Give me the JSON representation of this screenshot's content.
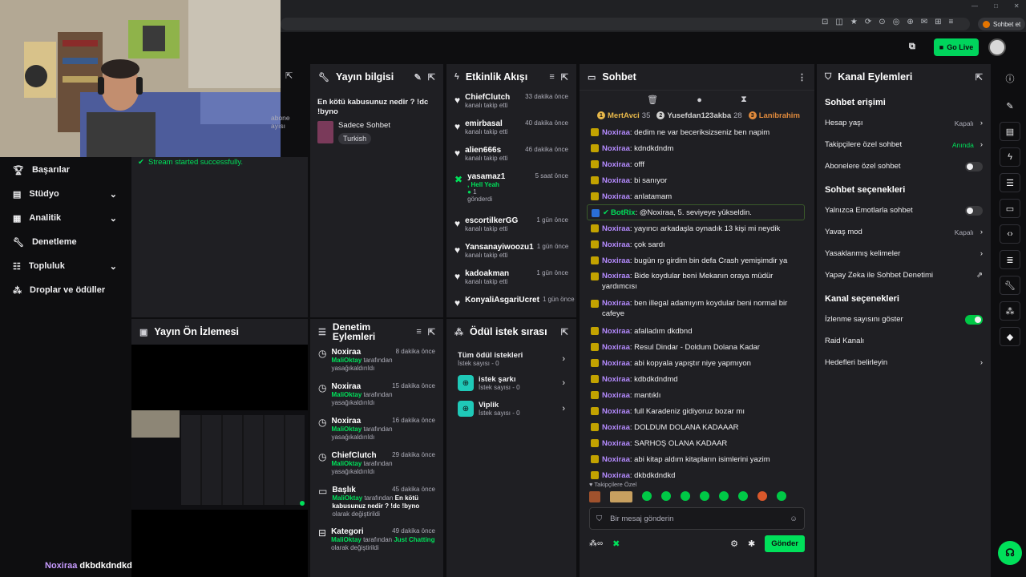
{
  "browser": {
    "profile_label": "Sohbet et"
  },
  "header": {
    "go_live": "Go Live"
  },
  "overlay": {
    "chat_user": "Noxiraa",
    "chat_text": "dkbdkdndkd",
    "partial_text": "abone\nayısı"
  },
  "sidebar": {
    "items": [
      {
        "label": "Başarılar",
        "icon": "trophy-icon"
      },
      {
        "label": "Stüdyo",
        "icon": "studio-icon",
        "expandable": true
      },
      {
        "label": "Analitik",
        "icon": "chart-icon",
        "expandable": true
      },
      {
        "label": "Denetleme",
        "icon": "wrench-icon"
      },
      {
        "label": "Topluluk",
        "icon": "community-icon",
        "expandable": true
      },
      {
        "label": "Droplar ve ödüller",
        "icon": "gift-icon"
      }
    ]
  },
  "stream_status": {
    "text": "Stream started successfully."
  },
  "stream_info": {
    "title": "Yayın bilgisi",
    "stream_title": "En kötü kabusunuz nedir ? !dc !byno",
    "category": "Sadece Sohbet",
    "tag": "Turkish"
  },
  "activity": {
    "title": "Etkinlik Akışı",
    "items": [
      {
        "name": "ChiefClutch",
        "sub": "kanalı takip etti",
        "time": "33 dakika önce"
      },
      {
        "name": "emirbasal",
        "sub": "kanalı takip etti",
        "time": "40 dakika önce"
      },
      {
        "name": "alien666s",
        "sub": "kanalı takip etti",
        "time": "46 dakika önce"
      },
      {
        "name": "yasamaz1",
        "sub": ", Hell Yeah",
        "sub2": "1",
        "sub3": "gönderdi",
        "time": "5 saat önce"
      },
      {
        "name": "escortilkerGG",
        "sub": "kanalı takip etti",
        "time": "1 gün önce"
      },
      {
        "name": "Yansanayiwoozu1",
        "sub": "kanalı takip etti",
        "time": "1 gün önce"
      },
      {
        "name": "kadoakman",
        "sub": "kanalı takip etti",
        "time": "1 gün önce"
      },
      {
        "name": "KonyaliAsgariUcret",
        "sub": "",
        "time": "1 gün önce"
      }
    ]
  },
  "chat": {
    "title": "Sohbet",
    "leaders": [
      {
        "rank": "1",
        "name": "MertAvci",
        "score": "35",
        "color": "#e8b84a"
      },
      {
        "rank": "2",
        "name": "Yusefdan123akba",
        "score": "28",
        "color": "#d0d0d0"
      },
      {
        "rank": "3",
        "name": "Lanibrahim",
        "score": "",
        "color": "#e08a3c"
      }
    ],
    "messages": [
      {
        "user": "Noxiraa",
        "text": ": dedim ne var beceriksizseniz ben napim"
      },
      {
        "user": "Noxiraa",
        "text": ": kdndkdndm"
      },
      {
        "user": "Noxiraa",
        "text": ": offf"
      },
      {
        "user": "Noxiraa",
        "text": ": bi sanıyor"
      },
      {
        "user": "Noxiraa",
        "text": ": anlatamam"
      },
      {
        "user": "BotRix",
        "text": ": @Noxiraa, 5. seviyeye yükseldin.",
        "bot": true
      },
      {
        "user": "Noxiraa",
        "text": ": yayıncı arkadaşla oynadık 13 kişi mi neydik"
      },
      {
        "user": "Noxiraa",
        "text": ": çok sardı"
      },
      {
        "user": "Noxiraa",
        "text": ": bugün rp girdim bin defa Crash yemişimdir ya"
      },
      {
        "user": "Noxiraa",
        "text": ": Bide koydular beni Mekanın oraya müdür yardımcısı",
        "two": true
      },
      {
        "user": "Noxiraa",
        "text": ": ben illegal adamıyım koydular beni normal bir cafeye",
        "two": true
      },
      {
        "user": "Noxiraa",
        "text": ": afalladım dkdbnd"
      },
      {
        "user": "Noxiraa",
        "text": ": Resul Dindar - Doldum Dolana Kadar"
      },
      {
        "user": "Noxiraa",
        "text": ": abi kopyala yapıştır niye yapmıyon"
      },
      {
        "user": "Noxiraa",
        "text": ": kdbdkdndmd"
      },
      {
        "user": "Noxiraa",
        "text": ": mantıklı"
      },
      {
        "user": "Noxiraa",
        "text": ": full Karadeniz gidiyoruz bozar mı"
      },
      {
        "user": "Noxiraa",
        "text": ": DOLDUM DOLANA KADAAAR"
      },
      {
        "user": "Noxiraa",
        "text": ": SARHOŞ OLANA KADAAR"
      },
      {
        "user": "Noxiraa",
        "text": ": abi kitap aldım kitapların isimlerini yazim"
      },
      {
        "user": "Noxiraa",
        "text": ": dkbdkdndkd"
      }
    ],
    "emote_section": "Takipçilere Özel",
    "input_placeholder": "Bir mesaj gönderin",
    "send_label": "Gönder"
  },
  "channel_actions": {
    "title": "Kanal Eylemleri",
    "sections": [
      {
        "heading": "Sohbet erişimi",
        "rows": [
          {
            "label": "Hesap yaşı",
            "value": "Kapalı",
            "kind": "arrow"
          },
          {
            "label": "Takipçilere özel sohbet",
            "value": "Anında",
            "kind": "arrow",
            "value_green": true
          },
          {
            "label": "Abonelere özel sohbet",
            "value": "",
            "kind": "toggle",
            "on": false
          }
        ]
      },
      {
        "heading": "Sohbet seçenekleri",
        "rows": [
          {
            "label": "Yalnızca Emotlarla sohbet",
            "value": "",
            "kind": "toggle",
            "on": false
          },
          {
            "label": "Yavaş mod",
            "value": "Kapalı",
            "kind": "arrow"
          },
          {
            "label": "Yasaklanmış kelimeler",
            "value": "",
            "kind": "arrow"
          },
          {
            "label": "Yapay Zeka ile Sohbet Denetimi",
            "value": "",
            "kind": "external"
          }
        ]
      },
      {
        "heading": "Kanal seçenekleri",
        "rows": [
          {
            "label": "İzlenme sayısını göster",
            "value": "",
            "kind": "toggle",
            "on": true
          },
          {
            "label": "Raid Kanalı",
            "value": "",
            "kind": "none"
          },
          {
            "label": "Hedefleri belirleyin",
            "value": "",
            "kind": "arrow"
          }
        ]
      }
    ]
  },
  "preview": {
    "title": "Yayın Ön İzlemesi"
  },
  "moderation": {
    "title": "Denetim Eylemleri",
    "items": [
      {
        "name": "Noxiraa",
        "time": "8 dakika önce",
        "actor": "MaliOktay",
        "mid": " tarafından yasağı",
        "obj": "",
        "tail": "kaldırıldı",
        "icon": "clock-icon"
      },
      {
        "name": "Noxiraa",
        "time": "15 dakika önce",
        "actor": "MaliOktay",
        "mid": " tarafından yasağı",
        "obj": "",
        "tail": "kaldırıldı",
        "icon": "clock-icon"
      },
      {
        "name": "Noxiraa",
        "time": "16 dakika önce",
        "actor": "MaliOktay",
        "mid": " tarafından yasağı",
        "obj": "",
        "tail": "kaldırıldı",
        "icon": "clock-icon"
      },
      {
        "name": "ChiefClutch",
        "time": "29 dakika önce",
        "actor": "MaliOktay",
        "mid": " tarafından yasağı",
        "obj": "",
        "tail": "kaldırıldı",
        "icon": "clock-icon"
      },
      {
        "name": "Başlık",
        "time": "45 dakika önce",
        "actor": "MaliOktay",
        "mid": " tarafından ",
        "obj": "En kötü kabusunuz nedir ? !dc !byno",
        "tail": " olarak değiştirildi",
        "icon": "title-icon"
      },
      {
        "name": "Kategori",
        "time": "49 dakika önce",
        "actor": "MaliOktay",
        "mid": " tarafından ",
        "obj": "Just Chatting",
        "tail": " olarak değiştirildi",
        "icon": "category-icon"
      }
    ]
  },
  "rewards": {
    "title": "Ödül istek sırası",
    "all_label": "Tüm ödül istekleri",
    "all_count": "İstek sayısı - 0",
    "items": [
      {
        "name": "istek şarkı",
        "count": "İstek sayısı - 0"
      },
      {
        "name": "Viplik",
        "count": "İstek sayısı - 0"
      }
    ]
  },
  "colors": {
    "accent": "#00e05a",
    "user": "#b58bff",
    "panel": "#1f1f23"
  }
}
